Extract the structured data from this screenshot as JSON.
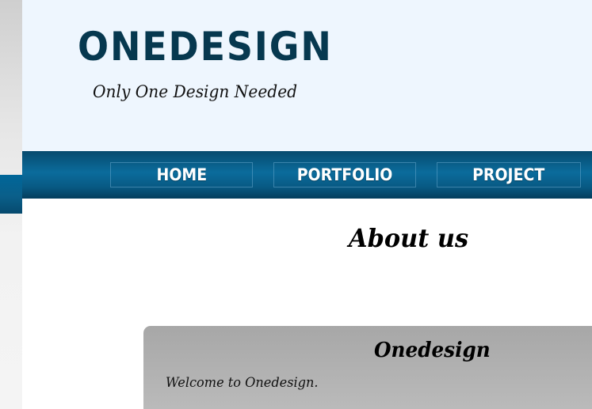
{
  "header": {
    "logo_text": "ONEDESIGN",
    "tagline": "Only One Design Needed"
  },
  "nav": {
    "items": [
      {
        "label": "HOME"
      },
      {
        "label": "PORTFOLIO"
      },
      {
        "label": "PROJECT"
      }
    ]
  },
  "main": {
    "page_title": "About us",
    "section_title": "Onedesign",
    "section_text": "Welcome to Onedesign."
  },
  "colors": {
    "brand_dark": "#06384f",
    "nav_blue": "#0b6c9c",
    "header_bg": "#eef6fe",
    "content_box_gray": "#b2b2b2"
  }
}
